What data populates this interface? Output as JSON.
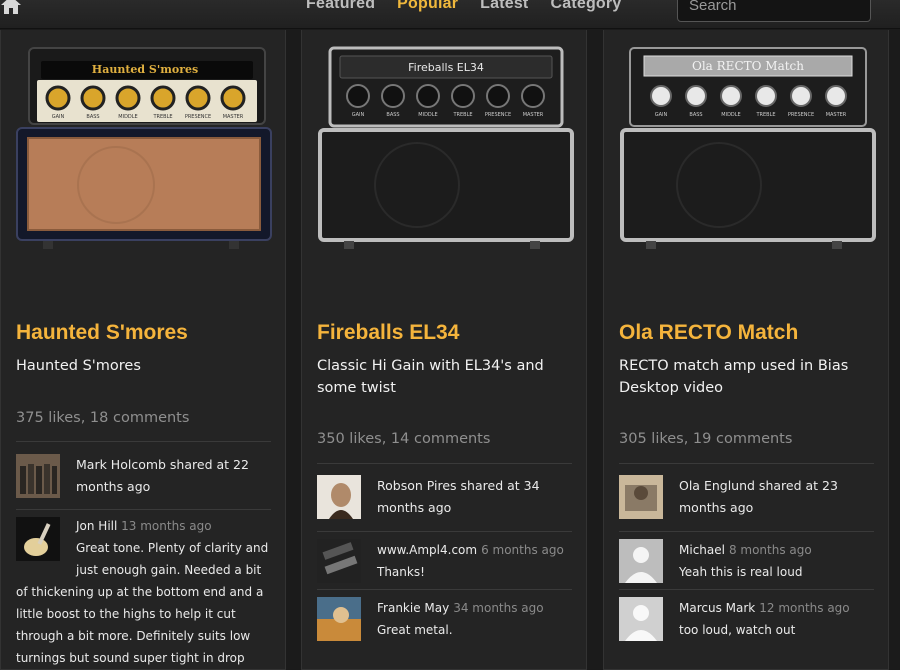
{
  "nav": {
    "items": [
      "Featured",
      "Popular",
      "Latest",
      "Category"
    ],
    "active": "Popular"
  },
  "search": {
    "placeholder": "Search"
  },
  "colors": {
    "accent": "#f5b43c",
    "background": "#1b1b1b",
    "card": "#242424"
  },
  "cards": [
    {
      "amp_name": "Haunted S'mores",
      "knobs": [
        "GAIN",
        "BASS",
        "MIDDLE",
        "TREBLE",
        "PRESENCE",
        "MASTER"
      ],
      "title": "Haunted S'mores",
      "description": "Haunted S'mores",
      "stats": "375 likes, 18 comments",
      "share": {
        "text": "Mark Holcomb shared at 22 months ago"
      },
      "comments": [
        {
          "name": "Jon Hill",
          "time": "13 months ago",
          "body": "Great tone. Plenty of clarity and just enough gain. Needed a bit of thickening up at the bottom end and a little boost to the highs to help it cut through a bit more. Definitely suits low turnings but sound super tight in drop"
        }
      ]
    },
    {
      "amp_name": "Fireballs EL34",
      "knobs": [
        "GAIN",
        "BASS",
        "MIDDLE",
        "TREBLE",
        "PRESENCE",
        "MASTER"
      ],
      "title": "Fireballs EL34",
      "description": "Classic Hi Gain with EL34's and some twist",
      "stats": "350 likes, 14 comments",
      "share": {
        "text": "Robson Pires shared at 34 months ago"
      },
      "comments": [
        {
          "name": "www.Ampl4.com",
          "time": "6 months ago",
          "body": "Thanks!"
        },
        {
          "name": "Frankie May",
          "time": "34 months ago",
          "body": "Great metal."
        }
      ]
    },
    {
      "amp_name": "Ola RECTO Match",
      "knobs": [
        "GAIN",
        "BASS",
        "MIDDLE",
        "TREBLE",
        "PRESENCE",
        "MASTER"
      ],
      "title": "Ola RECTO Match",
      "description": "RECTO match amp used in Bias Desktop video",
      "stats": "305 likes, 19 comments",
      "share": {
        "text": "Ola Englund shared at 23 months ago"
      },
      "comments": [
        {
          "name": "Michael",
          "time": "8 months ago",
          "body": "Yeah this is real loud"
        },
        {
          "name": "Marcus Mark",
          "time": "12 months ago",
          "body": "too loud, watch out"
        }
      ]
    }
  ]
}
